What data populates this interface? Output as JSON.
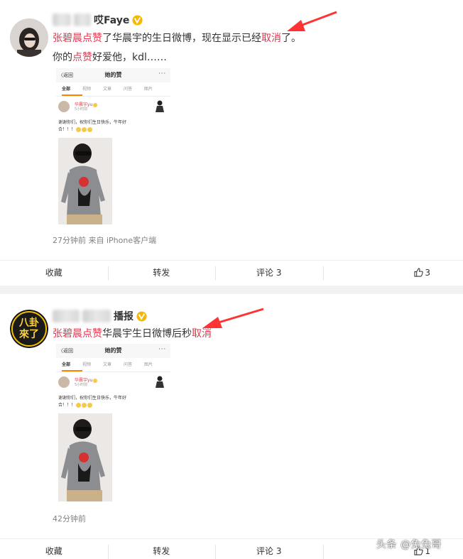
{
  "colors": {
    "highlight": "#e1364d",
    "arrow": "#ff3333",
    "accent_tab": "#ff8200",
    "meta": "#808080"
  },
  "post1": {
    "username_suffix": "哎Faye",
    "line1": {
      "red1": "张碧晨点赞",
      "text1": "了华晨宇的生日微博，现在显示已经",
      "red2": "取消",
      "text2": "了。"
    },
    "line2": {
      "text1": "你的",
      "red1": "点赞",
      "text2": "好爱他，kdl……"
    },
    "meta": "27分钟前  来自 iPhone客户端",
    "actions": {
      "collect": "收藏",
      "repost": "转发",
      "comment": "评论 3",
      "like": "3"
    }
  },
  "post2": {
    "username_suffix": "播报",
    "avatar_text": "八卦來了",
    "line1": {
      "red1": "张碧晨点赞",
      "text1": "华晨宇生日微博后秒",
      "red2": "取消"
    },
    "meta": "42分钟前",
    "actions": {
      "collect": "收藏",
      "repost": "转发",
      "comment": "评论 3",
      "like": "1"
    }
  },
  "screenshot": {
    "back": "〈返回",
    "title": "她的赞",
    "more": "···",
    "tabs": [
      "全部",
      "视频",
      "文章",
      "问答",
      "图片"
    ],
    "name": "华晨宇yu",
    "time": "5小时前",
    "text_line1": "谢谢你们，祝你们生日快乐，牛年好",
    "text_line2": "合！！！"
  },
  "watermark": "头条 @兔兔哥",
  "icons": [
    "verified-badge-icon",
    "arrow-icon",
    "thumb-up-icon",
    "emoji-icon"
  ]
}
